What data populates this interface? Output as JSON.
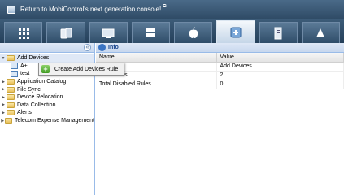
{
  "banner": {
    "text": "Return to MobiControl's next generation console!",
    "ext_glyph": "⧉"
  },
  "toolbar": {
    "tools": [
      {
        "icon": "grid-icon"
      },
      {
        "icon": "devices-icon"
      },
      {
        "icon": "desktops-icon"
      },
      {
        "icon": "windows-icon"
      },
      {
        "icon": "apple-icon"
      },
      {
        "icon": "rules-icon",
        "active": true
      },
      {
        "icon": "server-icon"
      },
      {
        "icon": "android-icon"
      }
    ]
  },
  "left": {
    "collapse_glyph": "«",
    "tree": [
      {
        "label": "Add Devices",
        "expanded": true,
        "selected": true
      },
      {
        "label": "A+",
        "child": true
      },
      {
        "label": "test",
        "child": true
      },
      {
        "label": "Application Catalog"
      },
      {
        "label": "File Sync"
      },
      {
        "label": "Device Relocation"
      },
      {
        "label": "Data Collection"
      },
      {
        "label": "Alerts"
      },
      {
        "label": "Telecom Expense Management"
      }
    ]
  },
  "info": {
    "title": "Info",
    "columns": [
      "Name",
      "Value"
    ],
    "rows": [
      {
        "name": "",
        "value": "Add Devices"
      },
      {
        "name": "Total Rules",
        "value": "2"
      },
      {
        "name": "Total Disabled Rules",
        "value": "0"
      }
    ]
  },
  "context_menu": {
    "item": "Create Add Devices Rule"
  }
}
